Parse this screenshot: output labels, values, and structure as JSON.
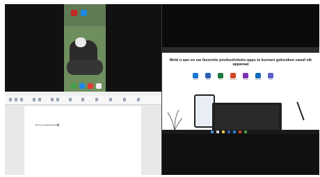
{
  "word": {
    "document_text": "Dit is een tekst bestand"
  },
  "office": {
    "headline": "Meld u aan en uw favoriete productiviteits-apps te kunnen gebruiken vanaf elk apparaat",
    "apps": [
      {
        "label": "Outlook",
        "icon": "outlook-icon",
        "color": "#1877d2"
      },
      {
        "label": "Word",
        "icon": "word-icon",
        "color": "#2b5fb8"
      },
      {
        "label": "Excel",
        "icon": "excel-icon",
        "color": "#1f7a44"
      },
      {
        "label": "PowerPoint",
        "icon": "powerpoint-icon",
        "color": "#d24726"
      },
      {
        "label": "OneNote",
        "icon": "onenote-icon",
        "color": "#7b2fb3"
      },
      {
        "label": "OneDrive",
        "icon": "onedrive-icon",
        "color": "#0f6cbd"
      },
      {
        "label": "Teams",
        "icon": "teams-icon",
        "color": "#5b5fc7"
      }
    ]
  },
  "phone": {
    "home_apps": [
      {
        "icon": "red-app-icon",
        "color": "#c62828"
      },
      {
        "icon": "blue-app-icon",
        "color": "#1e88e5"
      }
    ],
    "dock_apps": [
      {
        "icon": "phone-icon",
        "color": "#43a047"
      },
      {
        "icon": "messages-icon",
        "color": "#1e88e5"
      },
      {
        "icon": "browser-icon",
        "color": "#e53935"
      },
      {
        "icon": "camera-icon",
        "color": "#eeeeee"
      }
    ]
  }
}
